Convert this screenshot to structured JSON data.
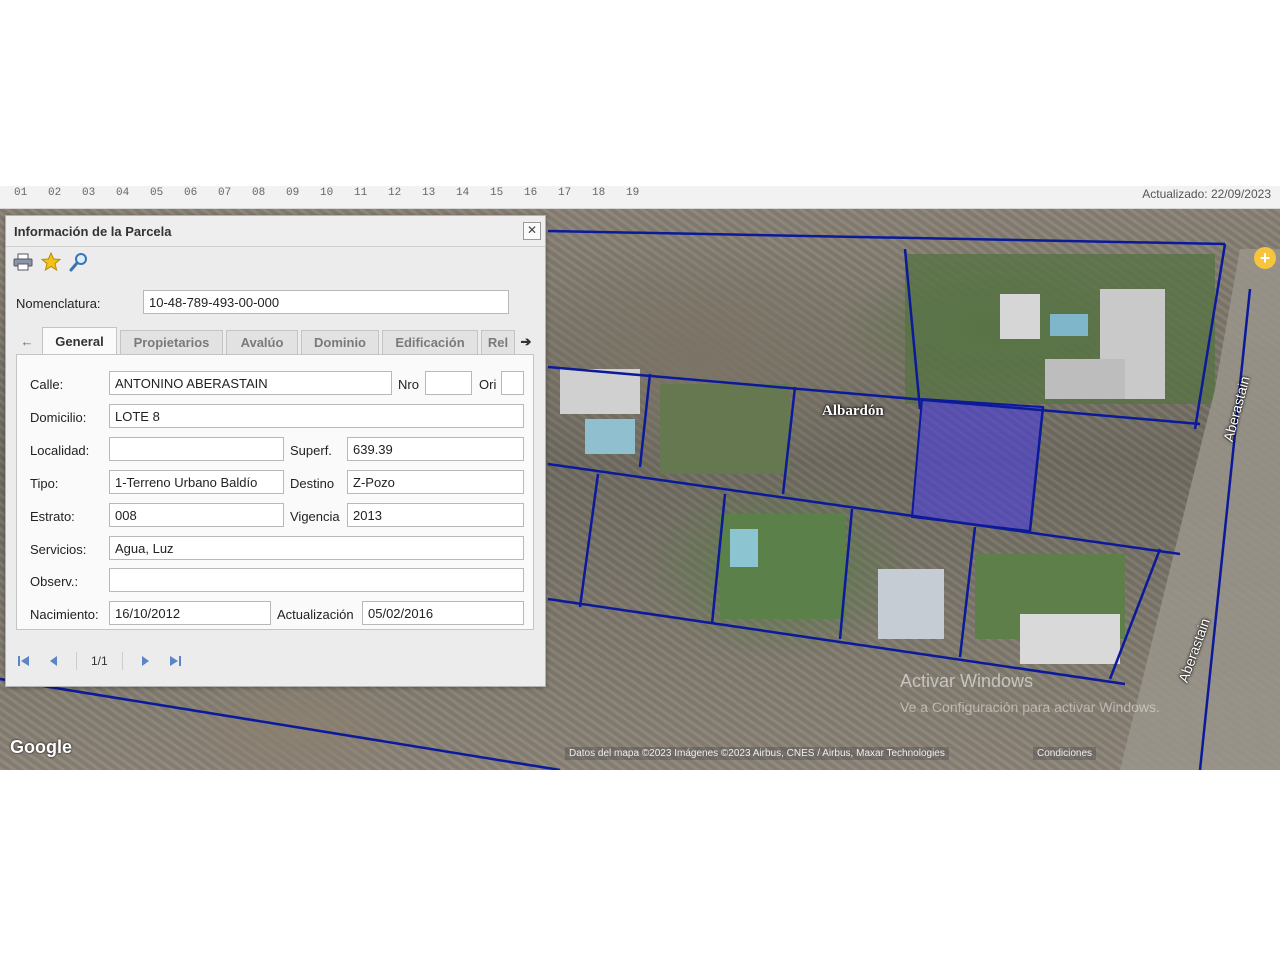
{
  "topbar": {
    "ruler": [
      "01",
      "02",
      "03",
      "04",
      "05",
      "06",
      "07",
      "08",
      "09",
      "10",
      "11",
      "12",
      "13",
      "14",
      "15",
      "16",
      "17",
      "18",
      "19"
    ],
    "updated": "Actualizado: 22/09/2023"
  },
  "map": {
    "labels": {
      "albardon": "Albardón",
      "aberastain_1": "Aberastain",
      "aberastain_2": "Aberastain"
    },
    "google_logo": "Google",
    "attribution": "Datos del mapa ©2023 Imágenes ©2023 Airbus, CNES / Airbus, Maxar Technologies",
    "conditions": "Condiciones",
    "watermark_1": "Activar Windows",
    "watermark_2": "Ve a Configuración para activar Windows."
  },
  "panel": {
    "title": "Información de la Parcela",
    "toolbar": [
      {
        "icon": "printer-icon"
      },
      {
        "icon": "star-icon"
      },
      {
        "icon": "magnifier-icon"
      }
    ],
    "nomenclatura": {
      "label": "Nomenclatura:",
      "value": "10-48-789-493-00-000"
    },
    "tabs": [
      "General",
      "Propietarios",
      "Avalúo",
      "Dominio",
      "Edificación",
      "Rel"
    ],
    "active_tab": "General",
    "form": {
      "calle": {
        "label": "Calle:",
        "value": "ANTONINO ABERASTAIN"
      },
      "nro": {
        "label": "Nro",
        "value": ""
      },
      "ori": {
        "label": "Ori",
        "value": ""
      },
      "domicilio": {
        "label": "Domicilio:",
        "value": "LOTE 8"
      },
      "localidad": {
        "label": "Localidad:",
        "value": ""
      },
      "superf": {
        "label": "Superf.",
        "value": "639.39"
      },
      "tipo": {
        "label": "Tipo:",
        "value": "1-Terreno Urbano Baldío"
      },
      "destino": {
        "label": "Destino",
        "value": "Z-Pozo"
      },
      "estrato": {
        "label": "Estrato:",
        "value": "008"
      },
      "vigencia": {
        "label": "Vigencia",
        "value": "2013"
      },
      "servicios": {
        "label": "Servicios:",
        "value": "Agua, Luz"
      },
      "observ": {
        "label": "Observ.:",
        "value": ""
      },
      "nacimiento": {
        "label": "Nacimiento:",
        "value": "16/10/2012"
      },
      "actualizacion": {
        "label": "Actualización",
        "value": "05/02/2016"
      }
    },
    "pager": {
      "page": "1/1"
    }
  },
  "colors": {
    "parcel_line": "#0a1a9a",
    "selected_parcel": "#4a3de0",
    "accent_button": "#f7c53b"
  }
}
